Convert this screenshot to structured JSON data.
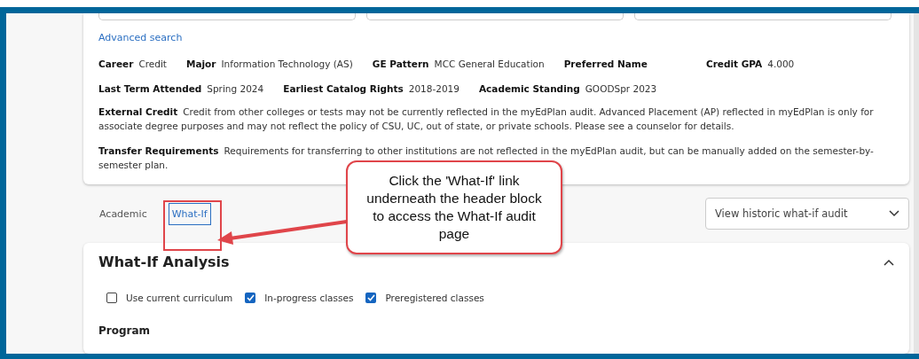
{
  "header_card": {
    "search_fields": [
      {
        "kind": "field"
      },
      {
        "kind": "field"
      },
      {
        "kind": "field"
      }
    ],
    "advanced_search": "Advanced search",
    "profile_rows": [
      [
        {
          "label": "Career",
          "value": "Credit"
        },
        {
          "label": "Major",
          "value": "Information Technology (AS)"
        },
        {
          "label": "GE Pattern",
          "value": "MCC General Education"
        },
        {
          "label": "Preferred Name"
        },
        {
          "label": "Credit GPA",
          "value": "4.000"
        }
      ],
      [
        {
          "label": "Last Term Attended",
          "value": "Spring 2024"
        },
        {
          "label": "Earliest Catalog Rights",
          "value": "2018-2019"
        },
        {
          "label": "Academic Standing",
          "value": "GOODSpr 2023"
        }
      ]
    ],
    "notes": [
      {
        "label": "External Credit",
        "text": "Credit from other colleges or tests may not be currently reflected in the myEdPlan audit. Advanced Placement (AP) reflected in myEdPlan is only for associate degree purposes and may not reflect the policy of CSU, UC, out of state, or private schools. Please see a counselor for details."
      },
      {
        "label": "Transfer Requirements",
        "text": "Requirements for transferring to other institutions are not reflected in the myEdPlan audit, but can be manually added on the semester-by-semester plan."
      }
    ]
  },
  "tabs": [
    {
      "label": "Academic",
      "selected": false
    },
    {
      "label": "What-If",
      "selected": true
    }
  ],
  "historic_dropdown": {
    "value": "View historic what-if audit"
  },
  "analysis": {
    "title": "What-If Analysis",
    "expanded": true,
    "options": [
      {
        "label": "Use current curriculum",
        "checked": false
      },
      {
        "label": "In-progress classes",
        "checked": true
      },
      {
        "label": "Preregistered classes",
        "checked": true
      }
    ],
    "program_label": "Program"
  },
  "annotation": {
    "text": "Click the 'What-If' link underneath the header block to access the What-If audit page"
  }
}
